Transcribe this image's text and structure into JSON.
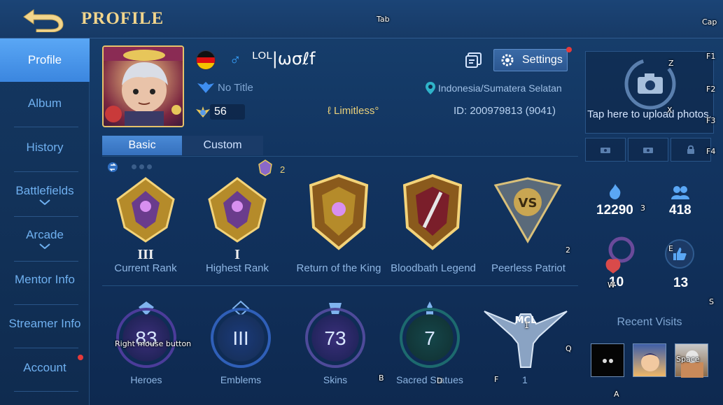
{
  "header": {
    "title": "PROFILE"
  },
  "key_hints": {
    "tab": "Tab",
    "cap": "Cap",
    "f1": "F1",
    "f2": "F2",
    "f3": "F3",
    "f4": "F4",
    "z": "Z",
    "x": "X",
    "three": "3",
    "e": "E",
    "w": "W",
    "s": "S",
    "two": "2",
    "q": "Q",
    "b": "B",
    "d": "D",
    "f": "F",
    "one": "1",
    "a": "A",
    "space": "Space",
    "rmb": "Right mouse button"
  },
  "sidebar": {
    "items": [
      {
        "label": "Profile"
      },
      {
        "label": "Album"
      },
      {
        "label": "History"
      },
      {
        "label": "Battlefields"
      },
      {
        "label": "Arcade"
      },
      {
        "label": "Mentor Info"
      },
      {
        "label": "Streamer Info"
      },
      {
        "label": "Account"
      }
    ]
  },
  "player": {
    "name": "ᴸᴼᴸ|ωσℓf",
    "gender_symbol": "♂",
    "title": "No Title",
    "level": "56",
    "limitless": "ℓ Limitless°",
    "location": "Indonesia/Sumatera Selatan",
    "id": "ID:  200979813 (9041)"
  },
  "settings": {
    "label": "Settings"
  },
  "tabs": {
    "basic": "Basic",
    "custom": "Custom"
  },
  "badges": {
    "count": "2",
    "items": [
      {
        "roman": "III",
        "label": "Current Rank"
      },
      {
        "roman": "I",
        "label": "Highest Rank"
      },
      {
        "roman": "",
        "label": "Return of the King"
      },
      {
        "roman": "",
        "label": "Bloodbath Legend"
      },
      {
        "roman": "",
        "label": "Peerless Patriot"
      }
    ]
  },
  "stats": [
    {
      "value": "83",
      "label": "Heroes"
    },
    {
      "value": "III",
      "label": "Emblems"
    },
    {
      "value": "73",
      "label": "Skins"
    },
    {
      "value": "7",
      "label": "Sacred Statues"
    }
  ],
  "mcl": {
    "label": "MCL",
    "count": "1"
  },
  "right_panel": {
    "upload_text": "Tap here to upload photos.",
    "popularity": "12290",
    "followers": "418",
    "charm": "10",
    "likes": "13",
    "recent_visits_title": "Recent Visits"
  },
  "colors": {
    "accent": "#4a8ad6",
    "gold": "#f2d58c",
    "sidebar_active": "#5aa7f5",
    "notification": "#e53a3a"
  }
}
